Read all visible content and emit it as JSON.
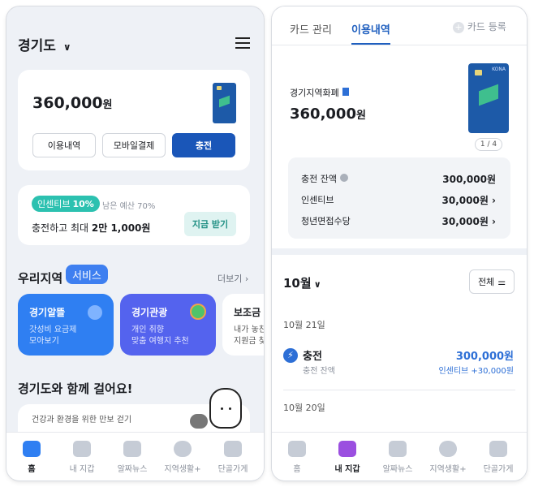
{
  "left": {
    "region": "경기도",
    "balance": "360,000",
    "won": "원",
    "buttons": [
      "이용내역",
      "모바일결제",
      "충전"
    ],
    "incentive": {
      "badge": "인센티브",
      "rate": "10%",
      "remain": "남은 예산 70%",
      "desc_prefix": "충전하고 최대 ",
      "amount": "2만 1,000원",
      "action": "지금 받기"
    },
    "region_section": {
      "title": "우리지역",
      "tag": "서비스",
      "more": "더보기"
    },
    "services": [
      {
        "title": "경기알뜰",
        "desc": "갓성비 요금제\n모아보기",
        "color": "#2f7ff2"
      },
      {
        "title": "경기관광",
        "desc": "개인 취향\n맞춤 여행지 추천",
        "color": "#5463ee"
      },
      {
        "title": "보조금",
        "desc": "내가 놓친\n지원금 찾"
      }
    ],
    "walk": {
      "title": "경기도와 함께 걸어요!",
      "desc": "건강과 환경을 위한 만보 걷기"
    },
    "tabs": [
      "홈",
      "내 지갑",
      "알짜뉴스",
      "지역생활+",
      "단골가게"
    ],
    "active_tab": 0
  },
  "right": {
    "top_tabs": [
      "카드 관리",
      "이용내역"
    ],
    "add_card": "카드 등록",
    "card_name": "경기지역화폐",
    "balance": "360,000",
    "won": "원",
    "card_page": "1 / 4",
    "card_brand": "KONA",
    "details": [
      {
        "label": "충전 잔액",
        "value": "300,000원"
      },
      {
        "label": "인센티브",
        "value": "30,000원"
      },
      {
        "label": "청년면접수당",
        "value": "30,000원"
      }
    ],
    "month": "10월",
    "filter": "전체",
    "date1": "10월 21일",
    "tx": {
      "title": "충전",
      "sub": "충전 잔액",
      "amount": "300,000원",
      "incentive": "인센티브 +30,000원"
    },
    "date2": "10월 20일",
    "tabs": [
      "홈",
      "내 지갑",
      "알짜뉴스",
      "지역생활+",
      "단골가게"
    ],
    "active_tab": 1
  },
  "colors": {
    "accent": "#1f5fbf",
    "primary_button": "#1a56b8",
    "incentive_badge": "#2cc1b0",
    "link_blue": "#2d6fd6"
  }
}
